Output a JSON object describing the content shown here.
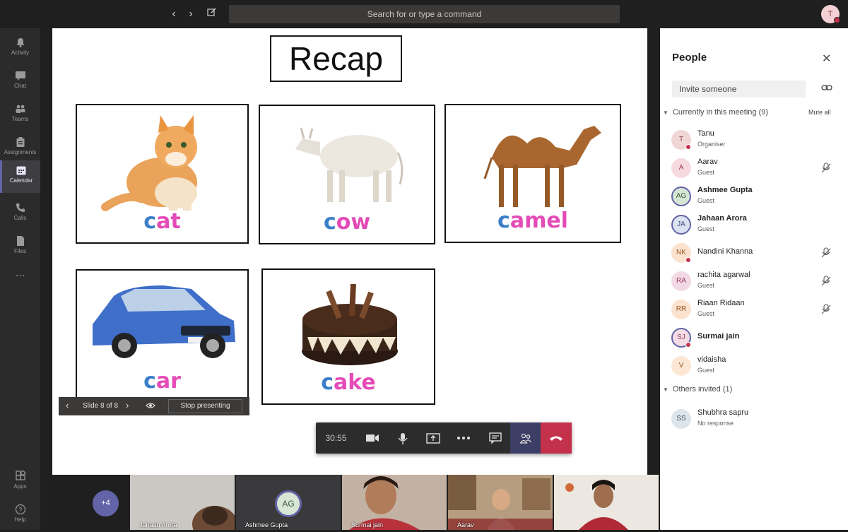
{
  "topbar": {
    "search_placeholder": "Search for or type a command",
    "user_initial": "T"
  },
  "rail": {
    "items": [
      {
        "label": "Activity"
      },
      {
        "label": "Chat"
      },
      {
        "label": "Teams"
      },
      {
        "label": "Assignments"
      },
      {
        "label": "Calendar"
      },
      {
        "label": "Calls"
      },
      {
        "label": "Files"
      },
      {
        "label": "..."
      },
      {
        "label": "Apps"
      },
      {
        "label": "Help"
      }
    ]
  },
  "slide": {
    "title": "Recap",
    "cards": [
      {
        "word_first": "c",
        "word_rest": "at"
      },
      {
        "word_first": "c",
        "word_rest": "ow"
      },
      {
        "word_first": "c",
        "word_rest": "amel"
      },
      {
        "word_first": "c",
        "word_rest": "ar"
      },
      {
        "word_first": "c",
        "word_rest": "ake"
      }
    ]
  },
  "slide_controls": {
    "label": "Slide 8 of 8",
    "stop_label": "Stop presenting"
  },
  "callbar": {
    "timer": "30:55"
  },
  "people_panel": {
    "title": "People",
    "invite_placeholder": "Invite someone",
    "current_section": "Currently in this meeting",
    "current_count": "(9)",
    "mute_all": "Mute all",
    "others_section": "Others invited",
    "others_count": "(1)",
    "participants": [
      {
        "initials": "T",
        "name": "Tanu",
        "role": "Organiser"
      },
      {
        "initials": "A",
        "name": "Aarav",
        "role": "Guest"
      },
      {
        "initials": "AG",
        "name": "Ashmee Gupta",
        "role": "Guest"
      },
      {
        "initials": "JA",
        "name": "Jahaan Arora",
        "role": "Guest"
      },
      {
        "initials": "NK",
        "name": "Nandini Khanna",
        "role": ""
      },
      {
        "initials": "RA",
        "name": "rachita agarwal",
        "role": "Guest"
      },
      {
        "initials": "RR",
        "name": "Riaan Ridaan",
        "role": "Guest"
      },
      {
        "initials": "SJ",
        "name": "Surmai jain",
        "role": ""
      },
      {
        "initials": "V",
        "name": "vidaisha",
        "role": "Guest"
      }
    ],
    "others": [
      {
        "initials": "SS",
        "name": "Shubhra sapru",
        "role": "No response"
      }
    ]
  },
  "filmstrip": {
    "more_count": "+4",
    "tiles": [
      {
        "name": "Jahaan Arora"
      },
      {
        "name": "Ashmee Gupta",
        "initials": "AG"
      },
      {
        "name": "Surmai jain"
      },
      {
        "name": "Aarav"
      },
      {
        "name": ""
      }
    ]
  },
  "colors": {
    "accent": "#6264a7",
    "hangup": "#c4314b",
    "word_pink": "#e44bb7",
    "word_blue": "#3b7ec9"
  }
}
